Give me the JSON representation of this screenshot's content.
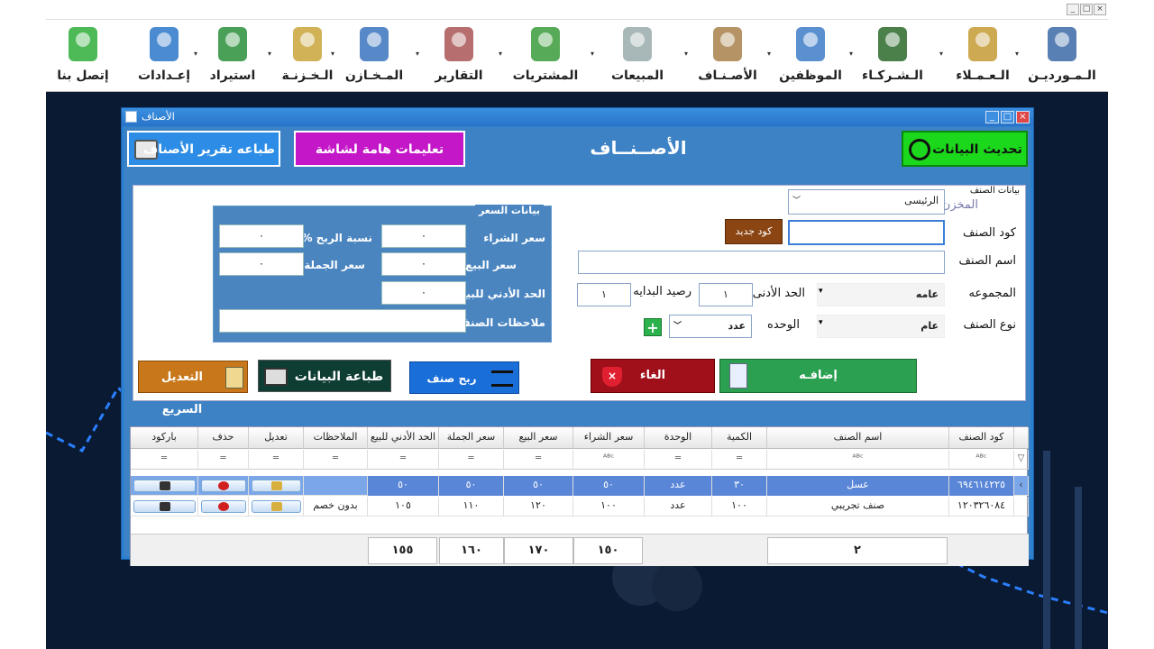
{
  "toolbar": {
    "items": [
      {
        "label": "الـمـورديـن",
        "icon": "supplier-icon"
      },
      {
        "label": "الـعـمـلاء",
        "icon": "customers-icon"
      },
      {
        "label": "الـشـركـاء",
        "icon": "partners-icon"
      },
      {
        "label": "الموظفين",
        "icon": "employees-icon"
      },
      {
        "label": "الأصـنـاف",
        "icon": "items-box-icon"
      },
      {
        "label": "المبيعات",
        "icon": "sales-calculator-icon"
      },
      {
        "label": "المشتريات",
        "icon": "purchases-cart-icon"
      },
      {
        "label": "التقارير",
        "icon": "reports-icon"
      },
      {
        "label": "المـخـازن",
        "icon": "warehouse-house-icon"
      },
      {
        "label": "الـخـزنـة",
        "icon": "safe-icon"
      },
      {
        "label": "استيراد",
        "icon": "excel-import-icon"
      },
      {
        "label": "إعـدادات",
        "icon": "settings-gear-icon"
      },
      {
        "label": "إتصل بنا",
        "icon": "phone-contact-icon"
      }
    ]
  },
  "window": {
    "title": "الأصناف"
  },
  "header": {
    "refresh": "تحديث البيانات",
    "title": "الأصــنــاف",
    "instructions": "تعليمات هامة لشاشة",
    "print_report": "طباعه تقرير الأصناف"
  },
  "form": {
    "section": "بيانات الصنف",
    "store_label": "المخزن",
    "store_value": "الرئيسى",
    "code_label": "كود الصنف",
    "code_value": "",
    "new_code": "كود جديد",
    "name_label": "اسم الصنف",
    "name_value": "",
    "group_label": "المجموعه",
    "group_value": "عامه",
    "min_label": "الحد الأدنى",
    "min_value": "١",
    "opening_label": "رصيد البدايه",
    "opening_value": "١",
    "type_label": "نوع الصنف",
    "type_value": "عام",
    "unit_label": "الوحده",
    "unit_value": "عدد"
  },
  "price": {
    "legend": "بيانات السعر",
    "buy_label": "سعر الشراء",
    "buy": "٠",
    "profit_label": "نسبة الربح %",
    "profit": "٠",
    "sell_label": "سعر البيع",
    "sell": "٠",
    "wholesale_label": "سعر الجملة",
    "wholesale": "٠",
    "minsell_label": "الحد الأدني للبيع",
    "minsell": "٠",
    "notes_label": "ملاحظات الصنف",
    "notes": ""
  },
  "actions": {
    "add": "إضافـه",
    "cancel": "الغاء",
    "link": "ربح صنف",
    "print": "طباعة البيانات",
    "quick": "التعديل السريع"
  },
  "grid": {
    "columns": [
      "كود الصنف",
      "اسم الصنف",
      "الكمية",
      "الوحدة",
      "سعر الشراء",
      "سعر البيع",
      "سعر الجملة",
      "الحد الأدني للبيع",
      "الملاحظات",
      "تعديل",
      "حذف",
      "باركود"
    ],
    "rows": [
      [
        "٦٩٤٦١٤٢٢٥",
        "عسل",
        "٣٠",
        "عدد",
        "٥٠",
        "٥٠",
        "٥٠",
        "٥٠",
        "",
        "",
        "",
        ""
      ],
      [
        "١٢٠٣٢٦٠٨٤",
        "صنف تجريبي",
        "١٠٠",
        "عدد",
        "١٠٠",
        "١٢٠",
        "١١٠",
        "١٠٥",
        "بدون خصم",
        "",
        "",
        ""
      ]
    ],
    "footer": {
      "count": "٢",
      "buy_total": "١٥٠",
      "sell_total": "١٧٠",
      "wholesale_total": "١٦٠",
      "minsell_total": "١٥٥"
    }
  },
  "colors": {
    "accent": "#2c80d0",
    "header_bg": "#3d82c4",
    "refresh": "#1cd81c",
    "instructions": "#c418c8",
    "cancel": "#a0101a",
    "add": "#2aa050",
    "selected_row": "#7ba7e8"
  }
}
